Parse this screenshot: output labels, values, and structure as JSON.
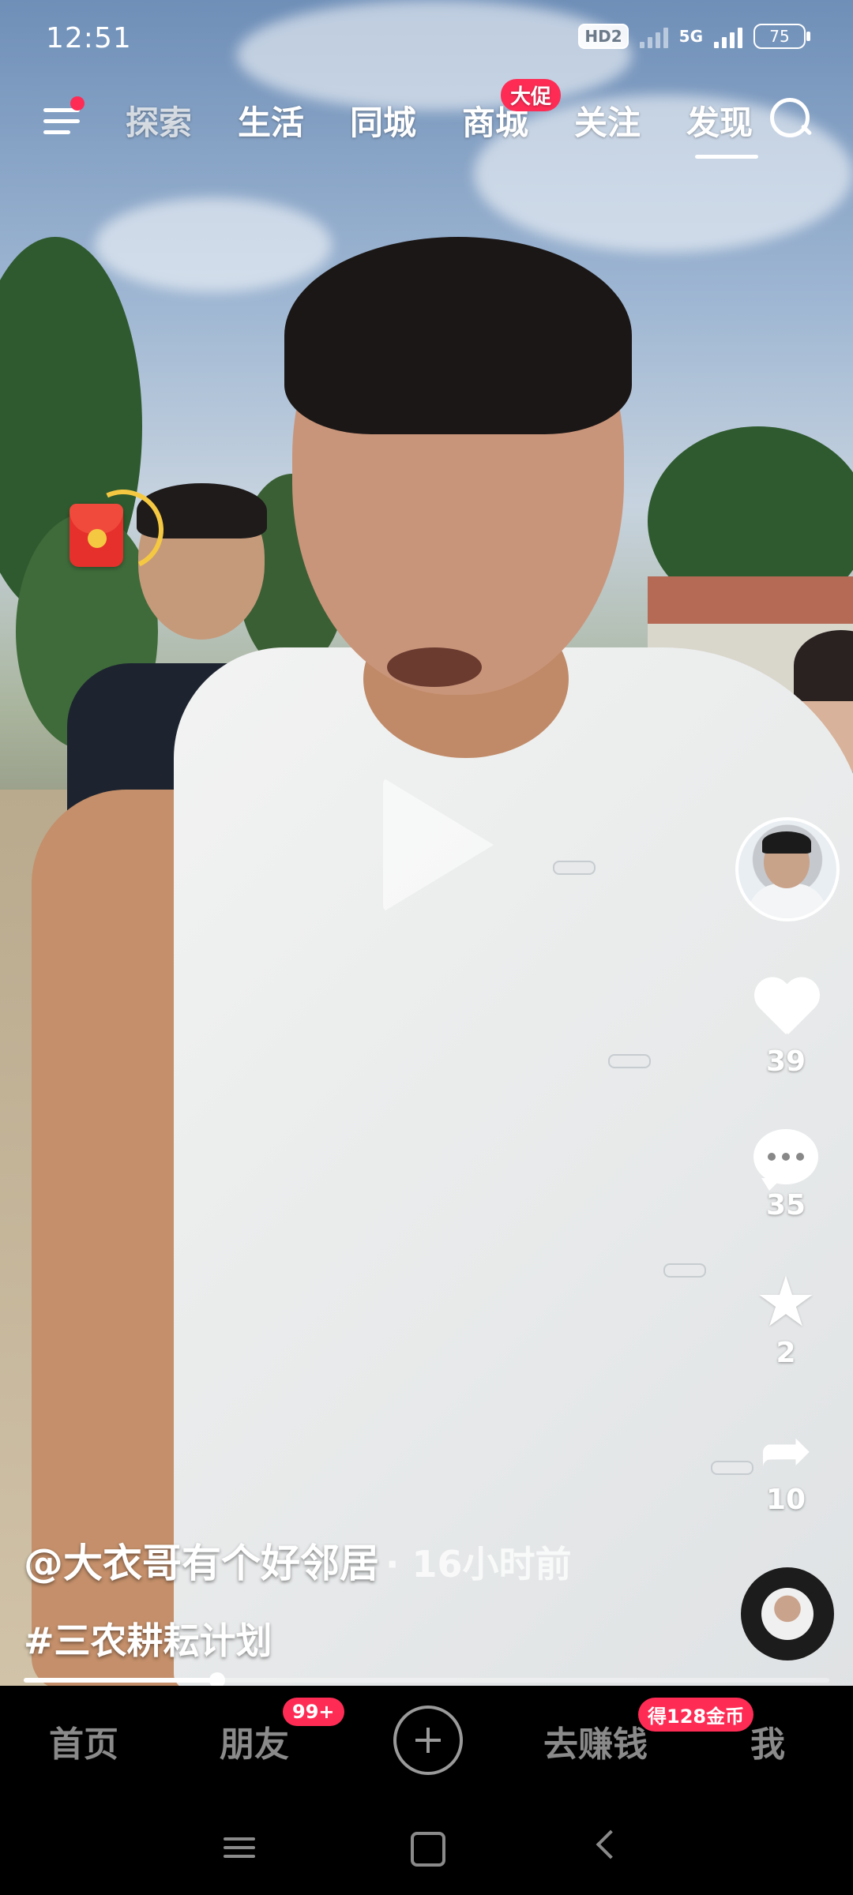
{
  "status_bar": {
    "time": "12:51",
    "hd_label": "HD2",
    "network_label": "5G",
    "battery": "75"
  },
  "top_nav": {
    "tabs": [
      {
        "label": "探索",
        "active": false
      },
      {
        "label": "生活",
        "active": false
      },
      {
        "label": "同城",
        "active": false
      },
      {
        "label": "商城",
        "active": false,
        "badge": "大促"
      },
      {
        "label": "关注",
        "active": false
      },
      {
        "label": "发现",
        "active": true
      }
    ]
  },
  "video": {
    "author": "@大衣哥有个好邻居",
    "time_ago": "· 16小时前",
    "hashtag": "#三农耕耘计划",
    "progress": 0.24
  },
  "actions": {
    "likes": "39",
    "comments": "35",
    "favorites": "2",
    "shares": "10"
  },
  "bottom_nav": {
    "home": "首页",
    "friends": "朋友",
    "friends_badge": "99+",
    "earn": "去赚钱",
    "earn_badge": "得128金币",
    "me": "我"
  },
  "colors": {
    "accent": "#fe2c55",
    "background": "#000000"
  },
  "icons": [
    "menu-icon",
    "search-icon",
    "red-packet-icon",
    "play-icon",
    "heart-icon",
    "comment-icon",
    "star-icon",
    "share-icon",
    "music-disc-icon",
    "plus-icon",
    "system-menu-icon",
    "system-home-icon",
    "system-back-icon"
  ]
}
